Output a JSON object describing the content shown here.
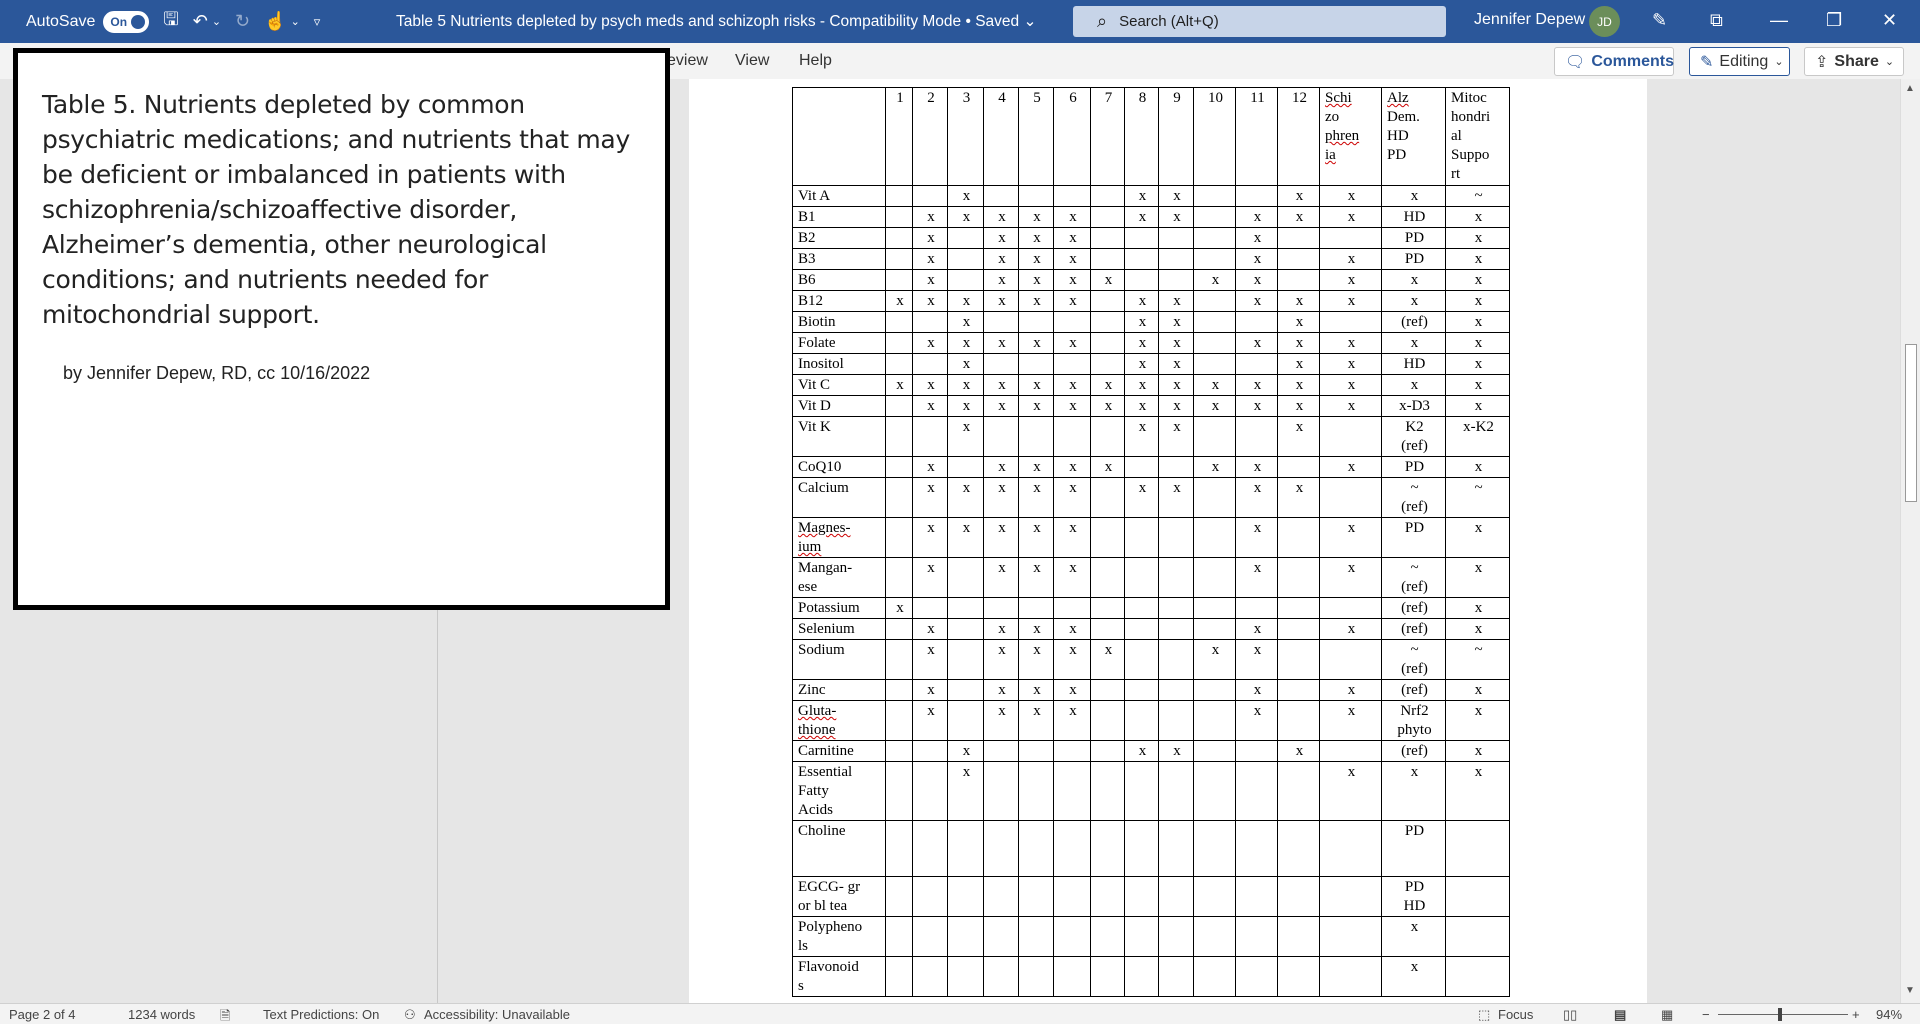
{
  "titlebar": {
    "autosave_label": "AutoSave",
    "autosave_state": "On",
    "doc_title": "Table 5 Nutrients depleted by psych meds and schizoph risks  -  Compatibility Mode • Saved",
    "search_placeholder": "Search (Alt+Q)",
    "user_name": "Jennifer Depew",
    "user_initials": "JD"
  },
  "ribbon": {
    "tabs": [
      "eview",
      "View",
      "Help"
    ],
    "comments_label": "Comments",
    "editing_label": "Editing",
    "share_label": "Share"
  },
  "textbox": {
    "caption": "Table 5. Nutrients depleted by common psychiatric medications; and nutrients that may be deficient or imbalanced in patients with schizophrenia/schizoaffective disorder, Alzheimer’s dementia, other neurological conditions; and nutrients needed for mitochondrial support.",
    "byline": "by Jennifer Depew, RD, cc 10/16/2022"
  },
  "table": {
    "headers": [
      "",
      "1",
      "2",
      "3",
      "4",
      "5",
      "6",
      "7",
      "8",
      "9",
      "10",
      "11",
      "12",
      "Schizo phrenia",
      "Alz Dem. HD PD",
      "Mitochondrial Support"
    ],
    "header_lines": {
      "schizo": [
        "Schi",
        "zo",
        "phren",
        "ia"
      ],
      "alz": [
        "Alz",
        "Dem.",
        "HD",
        "PD"
      ],
      "mito": [
        "Mitoc",
        "hondri",
        "al",
        "Suppo",
        "rt"
      ]
    },
    "rows": [
      {
        "label": [
          "Vit A"
        ],
        "cells": [
          "",
          "",
          "x",
          "",
          "",
          "",
          "",
          "x",
          "x",
          "",
          "",
          "x",
          "x",
          "x",
          "~"
        ]
      },
      {
        "label": [
          "B1"
        ],
        "cells": [
          "",
          "x",
          "x",
          "x",
          "x",
          "x",
          "",
          "x",
          "x",
          "",
          "x",
          "x",
          "x",
          "HD",
          "x"
        ]
      },
      {
        "label": [
          "B2"
        ],
        "cells": [
          "",
          "x",
          "",
          "x",
          "x",
          "x",
          "",
          "",
          "",
          "",
          "x",
          "",
          "",
          "PD",
          "x"
        ]
      },
      {
        "label": [
          "B3"
        ],
        "cells": [
          "",
          "x",
          "",
          "x",
          "x",
          "x",
          "",
          "",
          "",
          "",
          "x",
          "",
          "x",
          "PD",
          "x"
        ]
      },
      {
        "label": [
          "B6"
        ],
        "cells": [
          "",
          "x",
          "",
          "x",
          "x",
          "x",
          "x",
          "",
          "",
          "x",
          "x",
          "",
          "x",
          "x",
          "x"
        ]
      },
      {
        "label": [
          "B12"
        ],
        "cells": [
          "x",
          "x",
          "x",
          "x",
          "x",
          "x",
          "",
          "x",
          "x",
          "",
          "x",
          "x",
          "x",
          "x",
          "x"
        ]
      },
      {
        "label": [
          "Biotin"
        ],
        "cells": [
          "",
          "",
          "x",
          "",
          "",
          "",
          "",
          "x",
          "x",
          "",
          "",
          "x",
          "",
          "(ref)",
          "x"
        ]
      },
      {
        "label": [
          "Folate"
        ],
        "cells": [
          "",
          "x",
          "x",
          "x",
          "x",
          "x",
          "",
          "x",
          "x",
          "",
          "x",
          "x",
          "x",
          "x",
          "x"
        ]
      },
      {
        "label": [
          "Inositol"
        ],
        "cells": [
          "",
          "",
          "x",
          "",
          "",
          "",
          "",
          "x",
          "x",
          "",
          "",
          "x",
          "x",
          "HD",
          "x"
        ]
      },
      {
        "label": [
          "Vit C"
        ],
        "cells": [
          "x",
          "x",
          "x",
          "x",
          "x",
          "x",
          "x",
          "x",
          "x",
          "x",
          "x",
          "x",
          "x",
          "x",
          "x"
        ]
      },
      {
        "label": [
          "Vit D"
        ],
        "cells": [
          "",
          "x",
          "x",
          "x",
          "x",
          "x",
          "x",
          "x",
          "x",
          "x",
          "x",
          "x",
          "x",
          "x-D3",
          "x"
        ]
      },
      {
        "label": [
          "Vit K"
        ],
        "cells": [
          "",
          "",
          "x",
          "",
          "",
          "",
          "",
          "x",
          "x",
          "",
          "",
          "x",
          "",
          "K2 (ref)",
          "x-K2"
        ]
      },
      {
        "label": [
          "CoQ10"
        ],
        "cells": [
          "",
          "x",
          "",
          "x",
          "x",
          "x",
          "x",
          "",
          "",
          "x",
          "x",
          "",
          "x",
          "PD",
          "x"
        ]
      },
      {
        "label": [
          "Calcium"
        ],
        "cells": [
          "",
          "x",
          "x",
          "x",
          "x",
          "x",
          "",
          "x",
          "x",
          "",
          "x",
          "x",
          "",
          "~ (ref)",
          "~"
        ]
      },
      {
        "label": [
          "Magnes-",
          "ium"
        ],
        "cells": [
          "",
          "x",
          "x",
          "x",
          "x",
          "x",
          "",
          "",
          "",
          "",
          "x",
          "",
          "x",
          "PD",
          "x"
        ]
      },
      {
        "label": [
          "Mangan-",
          "ese"
        ],
        "cells": [
          "",
          "x",
          "",
          "x",
          "x",
          "x",
          "",
          "",
          "",
          "",
          "x",
          "",
          "x",
          "~ (ref)",
          "x"
        ]
      },
      {
        "label": [
          "Potassium"
        ],
        "cells": [
          "x",
          "",
          "",
          "",
          "",
          "",
          "",
          "",
          "",
          "",
          "",
          "",
          "",
          "(ref)",
          "x"
        ]
      },
      {
        "label": [
          "Selenium"
        ],
        "cells": [
          "",
          "x",
          "",
          "x",
          "x",
          "x",
          "",
          "",
          "",
          "",
          "x",
          "",
          "x",
          "(ref)",
          "x"
        ]
      },
      {
        "label": [
          "Sodium"
        ],
        "cells": [
          "",
          "x",
          "",
          "x",
          "x",
          "x",
          "x",
          "",
          "",
          "x",
          "x",
          "",
          "",
          "~ (ref)",
          "~"
        ]
      },
      {
        "label": [
          "Zinc"
        ],
        "cells": [
          "",
          "x",
          "",
          "x",
          "x",
          "x",
          "",
          "",
          "",
          "",
          "x",
          "",
          "x",
          "(ref)",
          "x"
        ]
      },
      {
        "label": [
          "Gluta-",
          "thione"
        ],
        "cells": [
          "",
          "x",
          "",
          "x",
          "x",
          "x",
          "",
          "",
          "",
          "",
          "x",
          "",
          "x",
          "Nrf2 phyto",
          "x"
        ]
      },
      {
        "label": [
          "Carnitine"
        ],
        "cells": [
          "",
          "",
          "x",
          "",
          "",
          "",
          "",
          "x",
          "x",
          "",
          "",
          "x",
          "",
          "(ref)",
          "x"
        ]
      },
      {
        "label": [
          "Essential",
          "Fatty",
          "Acids"
        ],
        "cells": [
          "",
          "",
          "x",
          "",
          "",
          "",
          "",
          "",
          "",
          "",
          "",
          "",
          "x",
          "x",
          "x"
        ]
      },
      {
        "label": [
          "Choline"
        ],
        "cells": [
          "",
          "",
          "",
          "",
          "",
          "",
          "",
          "",
          "",
          "",
          "",
          "",
          "",
          "PD",
          ""
        ]
      },
      {
        "label": [
          "EGCG- gr",
          "or bl tea"
        ],
        "cells": [
          "",
          "",
          "",
          "",
          "",
          "",
          "",
          "",
          "",
          "",
          "",
          "",
          "",
          "PD HD",
          ""
        ]
      },
      {
        "label": [
          "Polypheno",
          "ls"
        ],
        "cells": [
          "",
          "",
          "",
          "",
          "",
          "",
          "",
          "",
          "",
          "",
          "",
          "",
          "",
          "x",
          ""
        ]
      },
      {
        "label": [
          "Flavonoid",
          "s"
        ],
        "cells": [
          "",
          "",
          "",
          "",
          "",
          "",
          "",
          "",
          "",
          "",
          "",
          "",
          "",
          "x",
          ""
        ]
      }
    ]
  },
  "statusbar": {
    "page": "Page 2 of 4",
    "words": "1234 words",
    "text_predictions": "Text Predictions: On",
    "accessibility": "Accessibility: Unavailable",
    "focus": "Focus",
    "zoom": "94%"
  }
}
